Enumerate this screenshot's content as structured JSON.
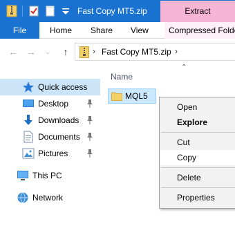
{
  "window": {
    "title": "Fast Copy MT5.zip",
    "extract_tab": "Extract"
  },
  "quick_access_toolbar": {
    "icons": [
      "folder-zip-icon",
      "properties-check-icon",
      "new-folder-icon",
      "customize-dropdown-icon"
    ]
  },
  "ribbon": {
    "tabs": [
      "File",
      "Home",
      "Share",
      "View",
      "Compressed Folde"
    ]
  },
  "address": {
    "path": "Fast Copy MT5.zip"
  },
  "nav": {
    "quick_access": "Quick access",
    "items": [
      "Desktop",
      "Downloads",
      "Documents",
      "Pictures"
    ],
    "this_pc": "This PC",
    "network": "Network"
  },
  "content": {
    "column_name": "Name",
    "files": [
      "MQL5"
    ]
  },
  "context_menu": {
    "items": [
      "Open",
      "Explore",
      "Cut",
      "Copy",
      "Delete",
      "Properties"
    ]
  },
  "colors": {
    "title_bar": "#1a73d0",
    "extract_tab": "#f7b5d6",
    "selection": "#cce4f7",
    "folder": "#f4cf66"
  }
}
